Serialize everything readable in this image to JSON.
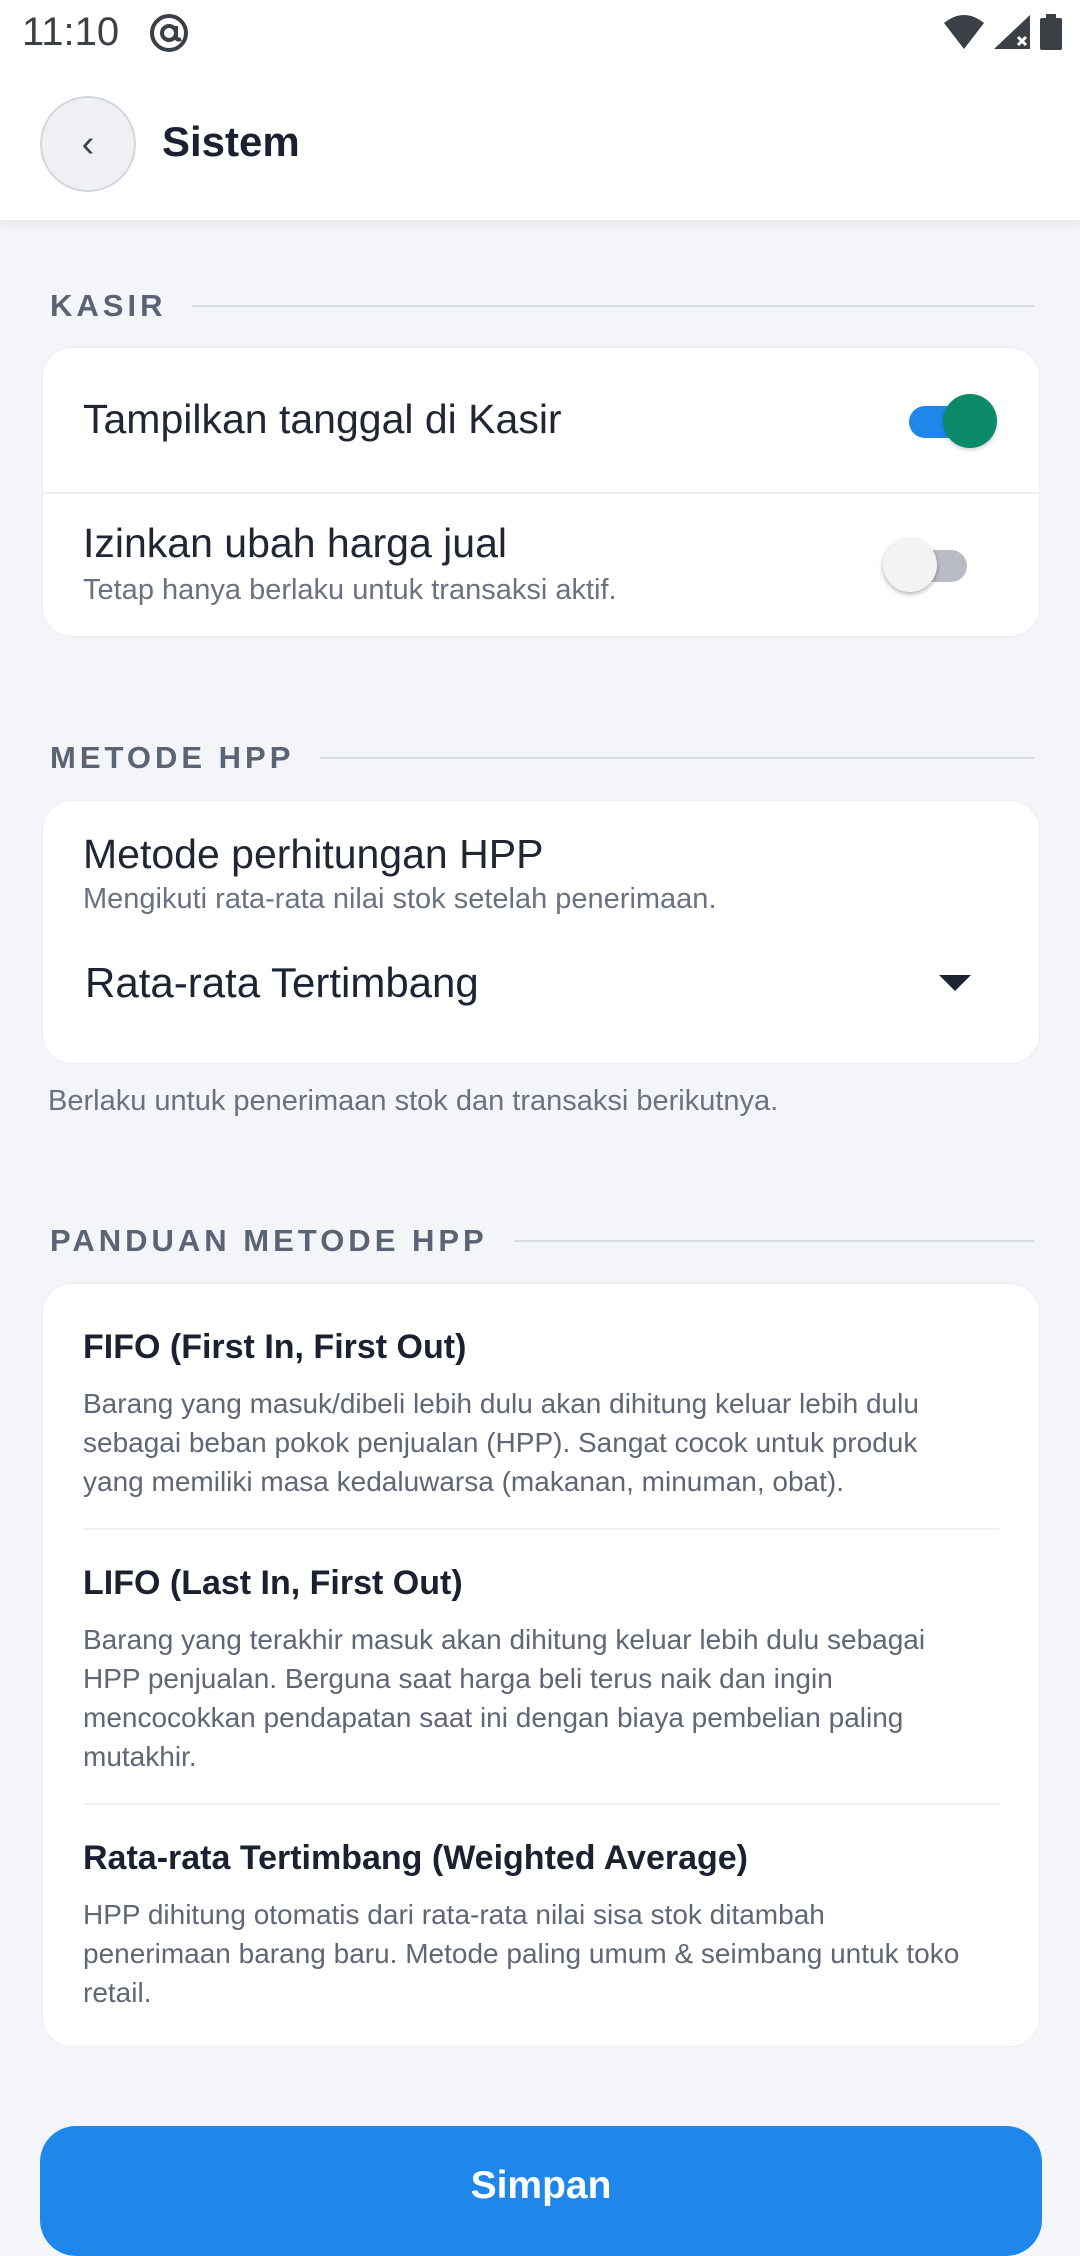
{
  "status_bar": {
    "time": "11:10",
    "icons": [
      "at-sign-icon",
      "wifi-icon",
      "signal-icon",
      "battery-icon"
    ]
  },
  "header": {
    "back_label": "‹",
    "title": "Sistem"
  },
  "kasir": {
    "section_label": "KASIR",
    "show_date": {
      "label": "Tampilkan tanggal di Kasir",
      "enabled": true
    },
    "allow_price_change": {
      "label": "Izinkan ubah harga jual",
      "sub": "Tetap hanya berlaku untuk transaksi aktif.",
      "enabled": false
    }
  },
  "hpp": {
    "section_label": "METODE HPP",
    "title": "Metode perhitungan HPP",
    "sub": "Mengikuti rata-rata nilai stok setelah penerimaan.",
    "selected": "Rata-rata Tertimbang",
    "note": "Berlaku untuk penerimaan stok dan transaksi berikutnya."
  },
  "guide": {
    "section_label": "PANDUAN METODE HPP",
    "items": [
      {
        "title": "FIFO (First In, First Out)",
        "lines": [
          "Barang yang masuk/dibeli lebih dulu akan dihitung keluar lebih dulu",
          "sebagai beban pokok penjualan (HPP). Sangat cocok untuk produk",
          "yang memiliki masa kedaluwarsa (makanan, minuman, obat)."
        ]
      },
      {
        "title": "LIFO (Last In, First Out)",
        "lines": [
          "Barang yang terakhir masuk akan dihitung keluar lebih dulu sebagai",
          "HPP penjualan. Berguna saat harga beli terus naik dan ingin",
          "mencocokkan pendapatan saat ini dengan biaya pembelian paling",
          "mutakhir."
        ]
      },
      {
        "title": "Rata-rata Tertimbang (Weighted Average)",
        "lines": [
          "HPP dihitung otomatis dari rata-rata nilai sisa stok ditambah",
          "penerimaan barang baru. Metode paling umum & seimbang untuk toko",
          "retail."
        ]
      }
    ]
  },
  "actions": {
    "save_label": "Simpan"
  },
  "colors": {
    "primary": "#1f87ea",
    "toggle_thumb_on": "#0b8a6a",
    "background": "#f3f5f8"
  }
}
